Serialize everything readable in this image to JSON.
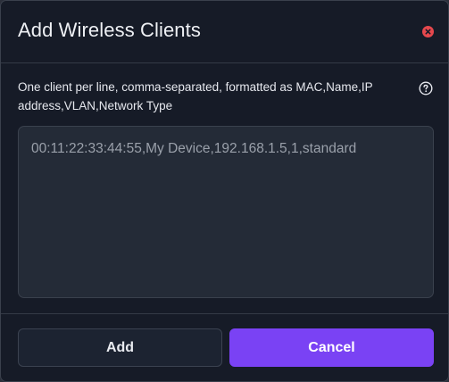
{
  "dialog": {
    "title": "Add Wireless Clients",
    "close_icon": "close-x-icon",
    "instructions": "One client per line, comma-separated, formatted as MAC,Name,IP address,VLAN,Network Type",
    "help_icon": "question-circle-icon",
    "textarea": {
      "value": "",
      "placeholder": "00:11:22:33:44:55,My Device,192.168.1.5,1,standard"
    },
    "buttons": {
      "add_label": "Add",
      "cancel_label": "Cancel"
    }
  },
  "colors": {
    "background": "#161b27",
    "primary": "#7a42f4",
    "close_icon": "#e5484d"
  }
}
